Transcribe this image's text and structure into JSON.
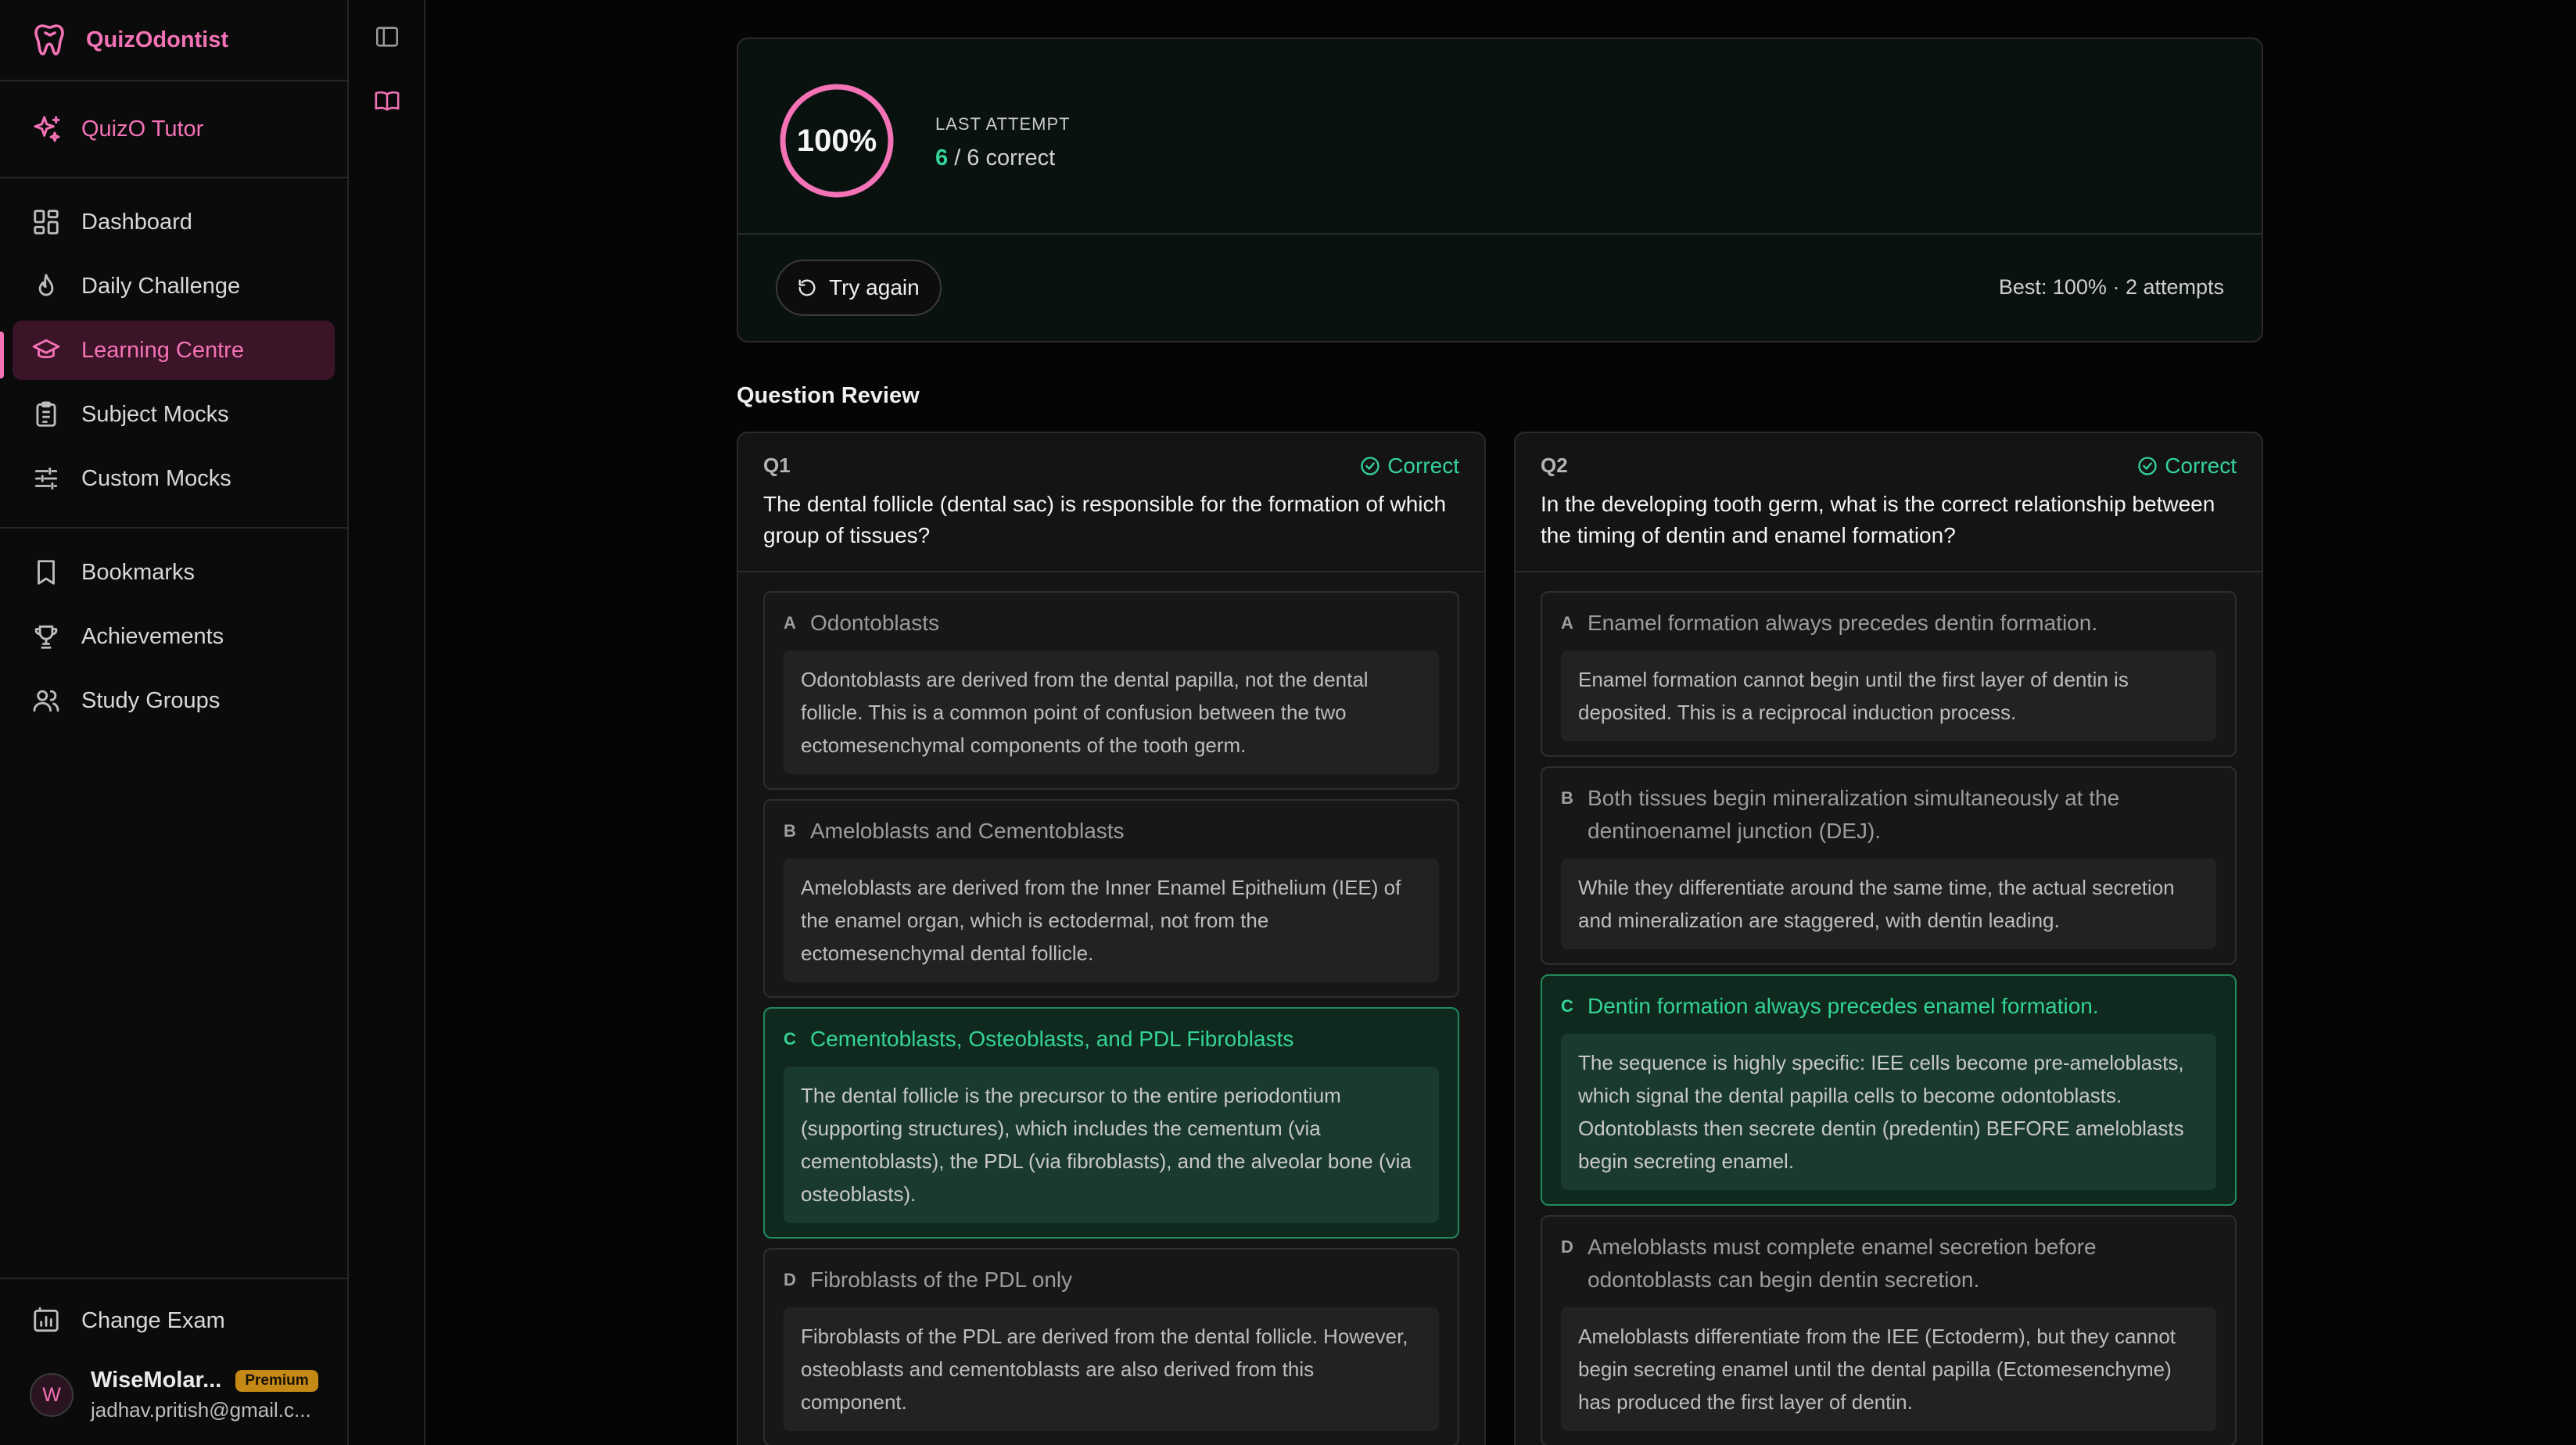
{
  "app": {
    "name": "QuizOdontist"
  },
  "sidebar": {
    "tutor_label": "QuizO Tutor",
    "items": [
      {
        "label": "Dashboard",
        "icon": "dashboard-icon"
      },
      {
        "label": "Daily Challenge",
        "icon": "flame-icon"
      },
      {
        "label": "Learning Centre",
        "icon": "graduation-cap-icon",
        "active": true
      },
      {
        "label": "Subject Mocks",
        "icon": "clipboard-icon"
      },
      {
        "label": "Custom Mocks",
        "icon": "sliders-icon"
      }
    ],
    "items2": [
      {
        "label": "Bookmarks",
        "icon": "bookmark-icon"
      },
      {
        "label": "Achievements",
        "icon": "trophy-icon"
      },
      {
        "label": "Study Groups",
        "icon": "users-icon"
      }
    ],
    "change_exam": "Change Exam",
    "user": {
      "initial": "W",
      "name": "WiseMolar...",
      "badge": "Premium",
      "email": "jadhav.pritish@gmail.c..."
    }
  },
  "score": {
    "percent": "100%",
    "percent_value": 100,
    "last_attempt_label": "LAST ATTEMPT",
    "correct": "6",
    "total_text": " / 6 correct",
    "try_again": "Try again",
    "best": "Best: 100% · 2 attempts"
  },
  "review_title": "Question Review",
  "questions": [
    {
      "num": "Q1",
      "status": "Correct",
      "text": "The dental follicle (dental sac) is responsible for the formation of which group of tissues?",
      "options": [
        {
          "letter": "A",
          "text": "Odontoblasts",
          "explanation": "Odontoblasts are derived from the dental papilla, not the dental follicle. This is a common point of confusion between the two ectomesenchymal components of the tooth germ."
        },
        {
          "letter": "B",
          "text": "Ameloblasts and Cementoblasts",
          "explanation": "Ameloblasts are derived from the Inner Enamel Epithelium (IEE) of the enamel organ, which is ectodermal, not from the ectomesenchymal dental follicle."
        },
        {
          "letter": "C",
          "text": "Cementoblasts, Osteoblasts, and PDL Fibroblasts",
          "explanation": "The dental follicle is the precursor to the entire periodontium (supporting structures), which includes the cementum (via cementoblasts), the PDL (via fibroblasts), and the alveolar bone (via osteoblasts).",
          "correct": true
        },
        {
          "letter": "D",
          "text": "Fibroblasts of the PDL only",
          "explanation": "Fibroblasts of the PDL are derived from the dental follicle. However, osteoblasts and cementoblasts are also derived from this component."
        }
      ]
    },
    {
      "num": "Q2",
      "status": "Correct",
      "text": "In the developing tooth germ, what is the correct relationship between the timing of dentin and enamel formation?",
      "options": [
        {
          "letter": "A",
          "text": "Enamel formation always precedes dentin formation.",
          "explanation": "Enamel formation cannot begin until the first layer of dentin is deposited. This is a reciprocal induction process."
        },
        {
          "letter": "B",
          "text": "Both tissues begin mineralization simultaneously at the dentinoenamel junction (DEJ).",
          "explanation": "While they differentiate around the same time, the actual secretion and mineralization are staggered, with dentin leading."
        },
        {
          "letter": "C",
          "text": "Dentin formation always precedes enamel formation.",
          "explanation": "The sequence is highly specific: IEE cells become pre-ameloblasts, which signal the dental papilla cells to become odontoblasts. Odontoblasts then secrete dentin (predentin) BEFORE ameloblasts begin secreting enamel.",
          "correct": true
        },
        {
          "letter": "D",
          "text": "Ameloblasts must complete enamel secretion before odontoblasts can begin dentin secretion.",
          "explanation": "Ameloblasts differentiate from the IEE (Ectoderm), but they cannot begin secreting enamel until the dental papilla (Ectomesenchyme) has produced the first layer of dentin."
        }
      ]
    }
  ],
  "colors": {
    "accent": "#f472b6",
    "success": "#34d399",
    "premium": "#c58a16"
  }
}
